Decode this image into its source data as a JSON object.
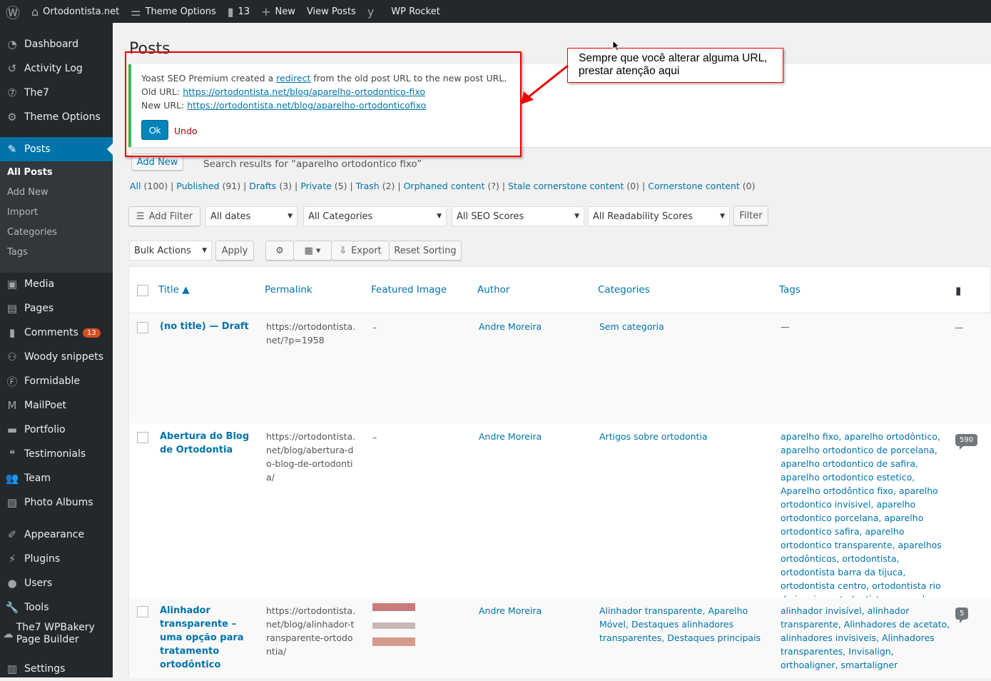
{
  "adminbar": {
    "site": "Ortodontista.net",
    "theme_options": "Theme Options",
    "comments": "13",
    "new": "New",
    "view_posts": "View Posts",
    "wp_rocket": "WP Rocket"
  },
  "sidebar": {
    "items": [
      {
        "label": "Dashboard",
        "icon": "dashboard-icon"
      },
      {
        "label": "Activity Log",
        "icon": "history-icon"
      },
      {
        "label": "The7",
        "icon": "the7-icon"
      },
      {
        "label": "Theme Options",
        "icon": "gear-icon"
      },
      {
        "label": "Posts",
        "icon": "pin-icon"
      },
      {
        "label": "Media",
        "icon": "media-icon"
      },
      {
        "label": "Pages",
        "icon": "pages-icon"
      },
      {
        "label": "Comments",
        "icon": "comment-icon",
        "badge": "13"
      },
      {
        "label": "Woody snippets",
        "icon": "snippets-icon"
      },
      {
        "label": "Formidable",
        "icon": "formidable-icon"
      },
      {
        "label": "MailPoet",
        "icon": "mailpoet-icon"
      },
      {
        "label": "Portfolio",
        "icon": "portfolio-icon"
      },
      {
        "label": "Testimonials",
        "icon": "testimonials-icon"
      },
      {
        "label": "Team",
        "icon": "team-icon"
      },
      {
        "label": "Photo Albums",
        "icon": "albums-icon"
      },
      {
        "label": "Appearance",
        "icon": "brush-icon"
      },
      {
        "label": "Plugins",
        "icon": "plugin-icon"
      },
      {
        "label": "Users",
        "icon": "user-icon"
      },
      {
        "label": "Tools",
        "icon": "wrench-icon"
      },
      {
        "label": "The7 WPBakery Page Builder",
        "icon": "builder-icon"
      },
      {
        "label": "Settings",
        "icon": "settings-icon"
      }
    ],
    "posts_sub": [
      "All Posts",
      "Add New",
      "Import",
      "Categories",
      "Tags"
    ]
  },
  "page": {
    "title": "Posts",
    "add_new": "Add New",
    "search_results": "Search results for “aparelho ortodontico fixo”"
  },
  "notice": {
    "line1_a": "Yoast SEO Premium created a ",
    "redirect": "redirect",
    "line1_b": " from the old post URL to the new post URL.",
    "old_label": "Old URL: ",
    "old_url": "https://ortodontista.net/blog/aparelho-ortodontico-fixo",
    "new_label": "New URL: ",
    "new_url": "https://ortodontista.net/blog/aparelho-ortodonticofixo",
    "ok": "Ok",
    "undo": "Undo"
  },
  "callout": {
    "text1": "Sempre que você alterar alguma URL,",
    "text2": "prestar atenção aqui",
    "color": "#e00000"
  },
  "views": [
    {
      "label": "All",
      "count": "(100)"
    },
    {
      "label": "Published",
      "count": "(91)"
    },
    {
      "label": "Drafts",
      "count": "(3)"
    },
    {
      "label": "Private",
      "count": "(5)"
    },
    {
      "label": "Trash",
      "count": "(2)"
    },
    {
      "label": "Orphaned content",
      "count": "(?)"
    },
    {
      "label": "Stale cornerstone content",
      "count": "(0)"
    },
    {
      "label": "Cornerstone content",
      "count": "(0)"
    }
  ],
  "filters": {
    "add_filter": "Add Filter",
    "dates": "All dates",
    "categories": "All Categories",
    "seo": "All SEO Scores",
    "readability": "All Readability Scores",
    "filter": "Filter"
  },
  "actions": {
    "bulk": "Bulk Actions",
    "apply": "Apply",
    "export": "Export",
    "reset": "Reset Sorting"
  },
  "table": {
    "headers": {
      "title": "Title ▲",
      "permalink": "Permalink",
      "featured": "Featured Image",
      "author": "Author",
      "categories": "Categories",
      "tags": "Tags"
    },
    "rows": [
      {
        "title": "(no title) — Draft",
        "permalink": "https://ortodontista.net/?p=1958",
        "featured": "–",
        "author": "Andre Moreira",
        "categories": "Sem categoria",
        "tags": "—",
        "comments": "—"
      },
      {
        "title": "Abertura do Blog de Ortodontia",
        "permalink": "https://ortodontista.net/blog/abertura-do-blog-de-ortodontia/",
        "featured": "–",
        "author": "Andre Moreira",
        "categories": "Artigos sobre ortodontia",
        "tags": "aparelho fixo, aparelho ortodôntico, aparelho ortodontico de porcelana, aparelho ortodontico de safira, aparelho ortodontico estetico, Aparelho ortodôntico fixo, aparelho ortodontico invisivel, aparelho ortodontico porcelana, aparelho ortodontico safira, aparelho ortodontico transparente, aparelhos ortodônticos, ortodontista, ortodontista barra da tijuca, ortodontista centro, ortodontista rio de janeiro, ortodontista zona sul",
        "comments": "590"
      },
      {
        "title": "Alinhador transparente – uma opção para tratamento ortodôntico",
        "permalink": "https://ortodontista.net/blog/alinhador-transparente-ortodontia/",
        "featured": "image",
        "author": "Andre Moreira",
        "categories": "Alinhador transparente, Aparelho Móvel, Destaques alinhadores transparentes, Destaques principais",
        "tags": "alinhador invisível, alinhador transparente, Alinhadores de acetato, alinhadores invisiveis, Alinhadores transparentes, Invisalign, orthoaligner, smartaligner",
        "comments": "5"
      }
    ]
  }
}
